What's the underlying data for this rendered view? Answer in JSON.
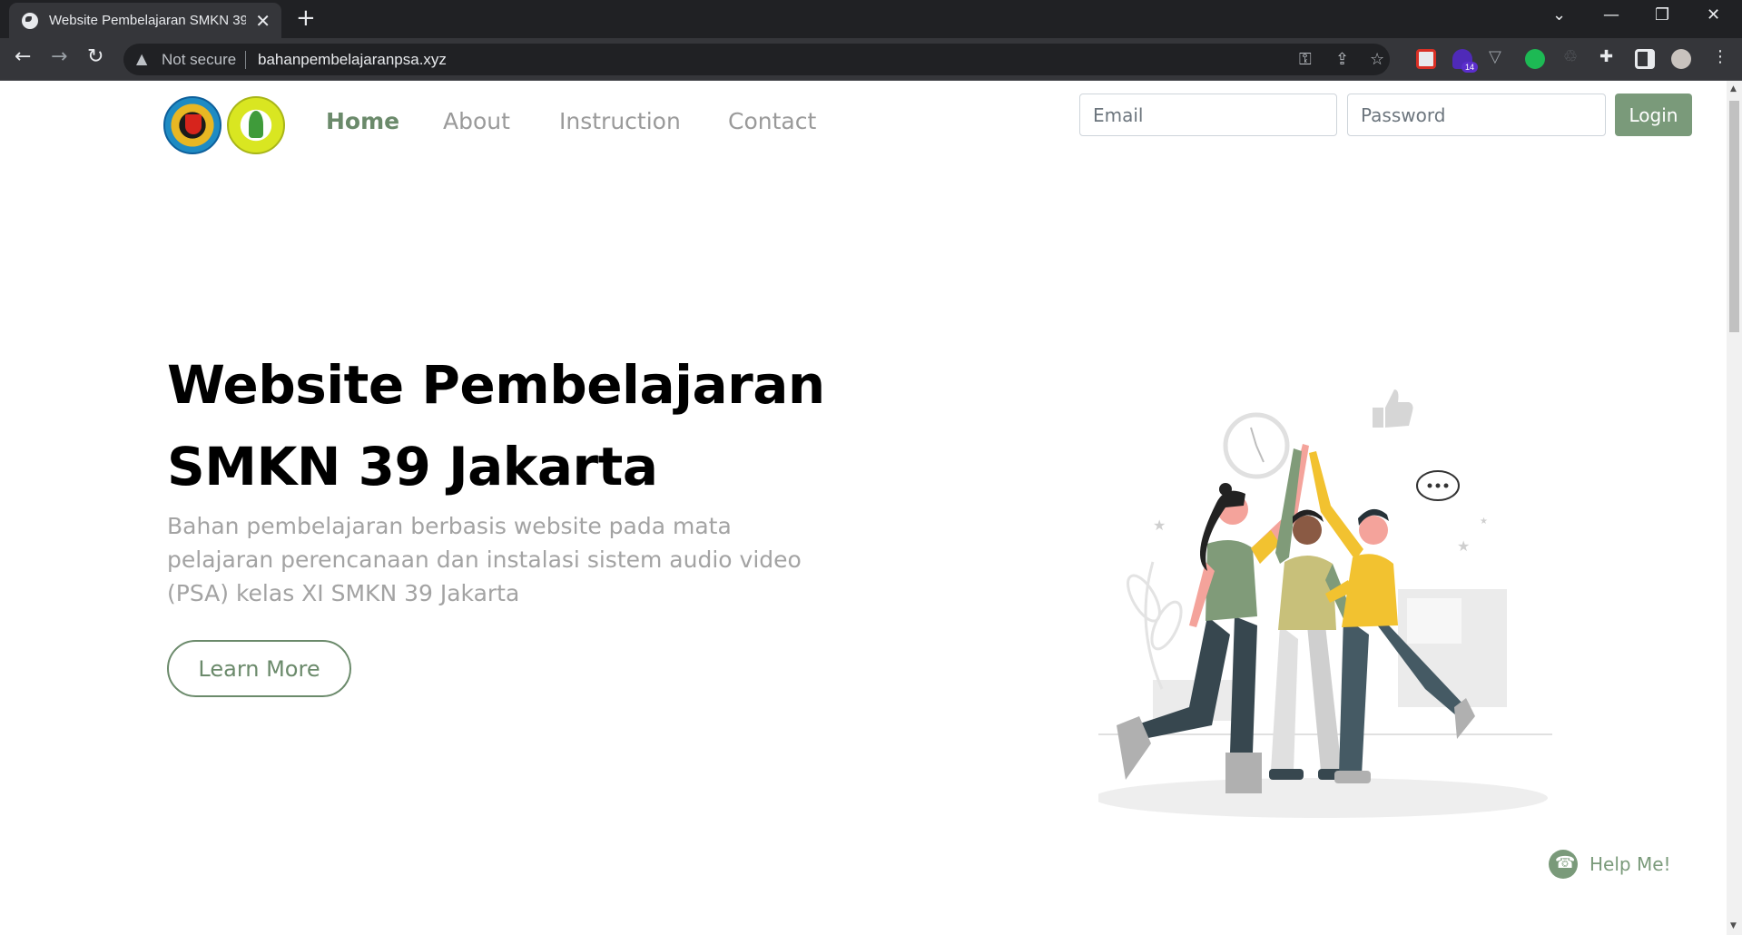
{
  "browser": {
    "tab_title": "Website Pembelajaran SMKN 39",
    "tab_close": "✕",
    "new_tab": "+",
    "security_label": "Not secure",
    "url": "bahanpembelajaranpsa.xyz",
    "extension_badge": "14",
    "window_controls": {
      "dropdown": "⌄",
      "minimize": "—",
      "restore": "❐",
      "close": "✕"
    }
  },
  "header": {
    "nav_items": [
      "Home",
      "About",
      "Instruction",
      "Contact"
    ],
    "active_nav": "Home",
    "email_placeholder": "Email",
    "password_placeholder": "Password",
    "login_label": "Login"
  },
  "hero": {
    "title_line1": "Website Pembelajaran",
    "title_line2": "SMKN 39 Jakarta",
    "description": "Bahan pembelajaran berbasis website pada mata pelajaran perencanaan dan instalasi sistem audio video (PSA) kelas XI SMKN 39 Jakarta",
    "cta_label": "Learn More"
  },
  "help": {
    "label": "Help Me!"
  },
  "colors": {
    "accent": "#7a9a7a",
    "accent_dark": "#6b8a6b",
    "muted_text": "#a3a3a3"
  }
}
